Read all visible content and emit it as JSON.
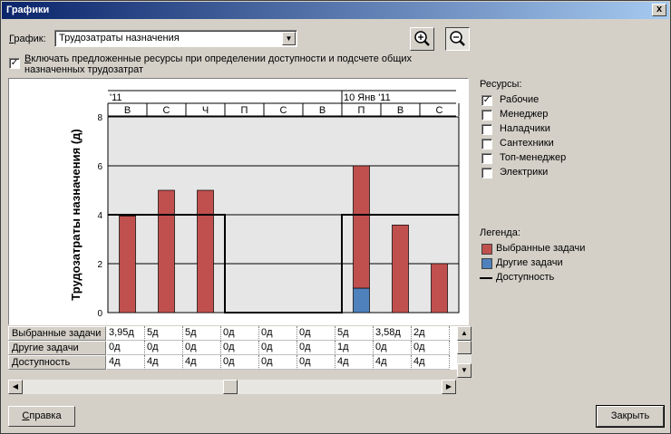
{
  "window": {
    "title": "Графики",
    "close_glyph": "x"
  },
  "graph_selector": {
    "label": "График:",
    "label_mnemonic": "Г",
    "label_rest": "рафик:",
    "selected": "Трудозатраты назначения"
  },
  "toolbar": {
    "zoom_in": "zoom-in-icon",
    "zoom_out": "zoom-out-icon"
  },
  "include_proposed": {
    "checked": true,
    "line1_mnemonic": "В",
    "line1_rest": "ключать предложенные ресурсы при определении доступности и подсчете общих",
    "line2": "назначенных трудозатрат"
  },
  "resources": {
    "title": "Ресурсы:",
    "items": [
      {
        "label": "Рабочие",
        "checked": true
      },
      {
        "label": "Менеджер",
        "checked": false
      },
      {
        "label": "Наладчики",
        "checked": false
      },
      {
        "label": "Сантехники",
        "checked": false
      },
      {
        "label": "Топ-менеджер",
        "checked": false
      },
      {
        "label": "Электрики",
        "checked": false
      }
    ]
  },
  "legend": {
    "title": "Легенда:",
    "selected_tasks": "Выбранные задачи",
    "other_tasks": "Другие задачи",
    "availability": "Доступность"
  },
  "colors": {
    "selected": "#c0504d",
    "other": "#4f81bd",
    "plot_bg": "#e6e6e6"
  },
  "chart_data": {
    "type": "bar",
    "ylabel": "Трудозатраты назначения (д)",
    "ylim": [
      0,
      8
    ],
    "yticks": [
      "0",
      "2",
      "4",
      "6",
      "8"
    ],
    "week_labels": [
      {
        "label": "'11",
        "col": 0
      },
      {
        "label": "10 Янв '11",
        "col": 6
      }
    ],
    "categories": [
      "В",
      "С",
      "Ч",
      "П",
      "С",
      "В",
      "П",
      "В",
      "С"
    ],
    "series": [
      {
        "name": "Выбранные задачи",
        "values": [
          3.95,
          5,
          5,
          0,
          0,
          0,
          5,
          3.58,
          2
        ]
      },
      {
        "name": "Другие задачи",
        "values": [
          0,
          0,
          0,
          0,
          0,
          0,
          1,
          0,
          0
        ]
      }
    ],
    "availability": [
      4,
      4,
      4,
      0,
      0,
      0,
      4,
      4,
      4
    ]
  },
  "table": {
    "rows": [
      {
        "label": "Выбранные задачи",
        "cells": [
          "3,95д",
          "5д",
          "5д",
          "0д",
          "0д",
          "0д",
          "5д",
          "3,58д",
          "2д"
        ]
      },
      {
        "label": "Другие задачи",
        "cells": [
          "0д",
          "0д",
          "0д",
          "0д",
          "0д",
          "0д",
          "1д",
          "0д",
          "0д"
        ]
      },
      {
        "label": "Доступность",
        "cells": [
          "4д",
          "4д",
          "4д",
          "0д",
          "0д",
          "0д",
          "4д",
          "4д",
          "4д"
        ]
      }
    ]
  },
  "buttons": {
    "help_mnemonic": "С",
    "help_rest": "правка",
    "close": "Закрыть"
  }
}
